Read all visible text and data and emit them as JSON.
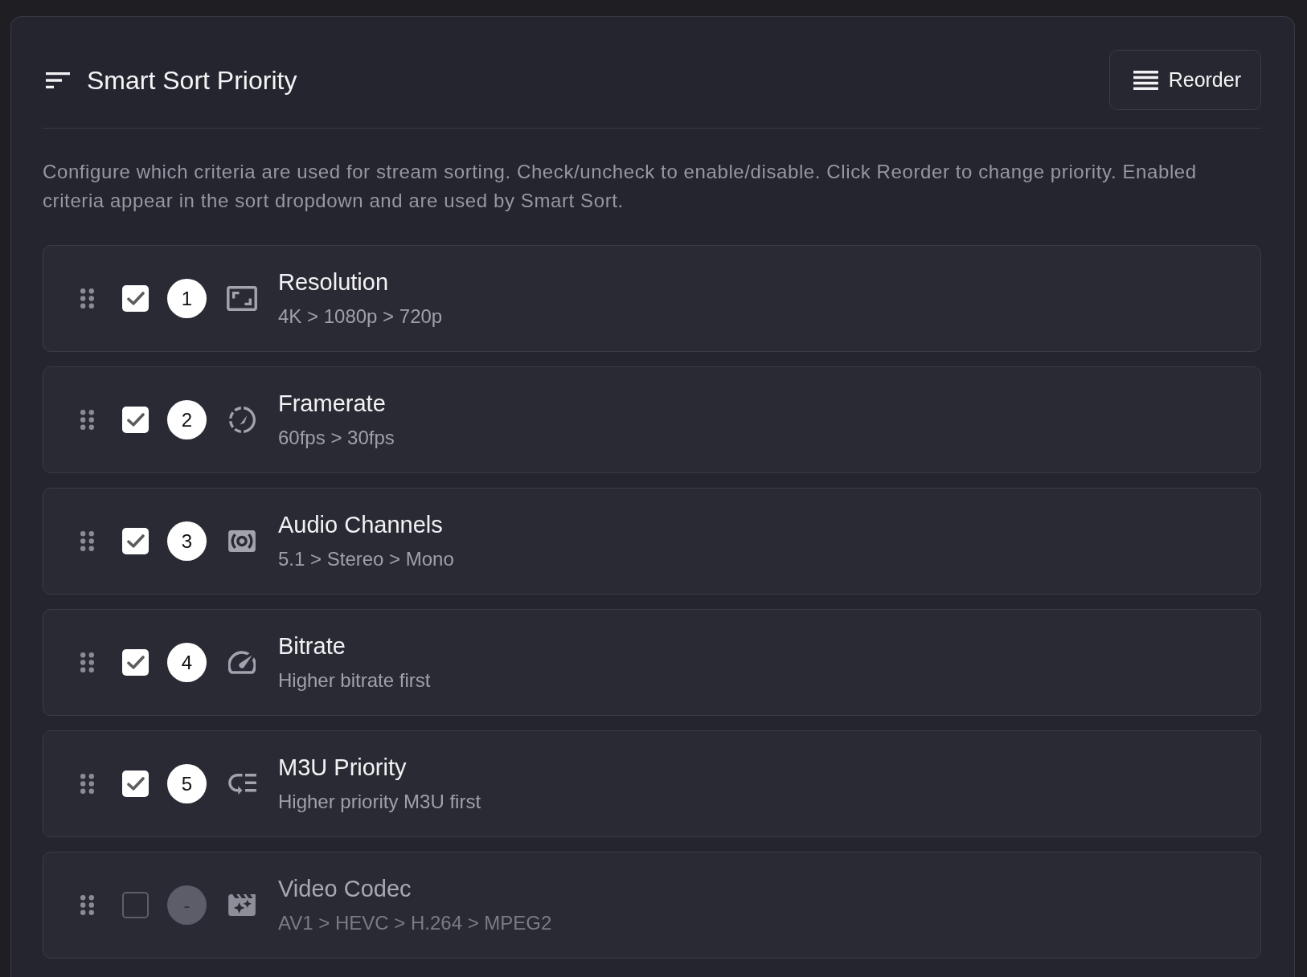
{
  "panel": {
    "title": "Smart Sort Priority",
    "reorder_button": "Reorder",
    "description": "Configure which criteria are used for stream sorting. Check/uncheck to enable/disable. Click Reorder to change priority. Enabled criteria appear in the sort dropdown and are used by Smart Sort.",
    "criteria": [
      {
        "kind": "resolution",
        "name": "Resolution",
        "detail": "4K > 1080p > 720p",
        "rank": "1",
        "checked": true
      },
      {
        "kind": "framerate",
        "name": "Framerate",
        "detail": "60fps > 30fps",
        "rank": "2",
        "checked": true
      },
      {
        "kind": "audio",
        "name": "Audio Channels",
        "detail": "5.1 > Stereo > Mono",
        "rank": "3",
        "checked": true
      },
      {
        "kind": "bitrate",
        "name": "Bitrate",
        "detail": "Higher bitrate first",
        "rank": "4",
        "checked": true
      },
      {
        "kind": "m3u",
        "name": "M3U Priority",
        "detail": "Higher priority M3U first",
        "rank": "5",
        "checked": true
      },
      {
        "kind": "codec",
        "name": "Video Codec",
        "detail": "AV1 > HEVC > H.264 > MPEG2",
        "rank": "-",
        "checked": false
      }
    ]
  }
}
